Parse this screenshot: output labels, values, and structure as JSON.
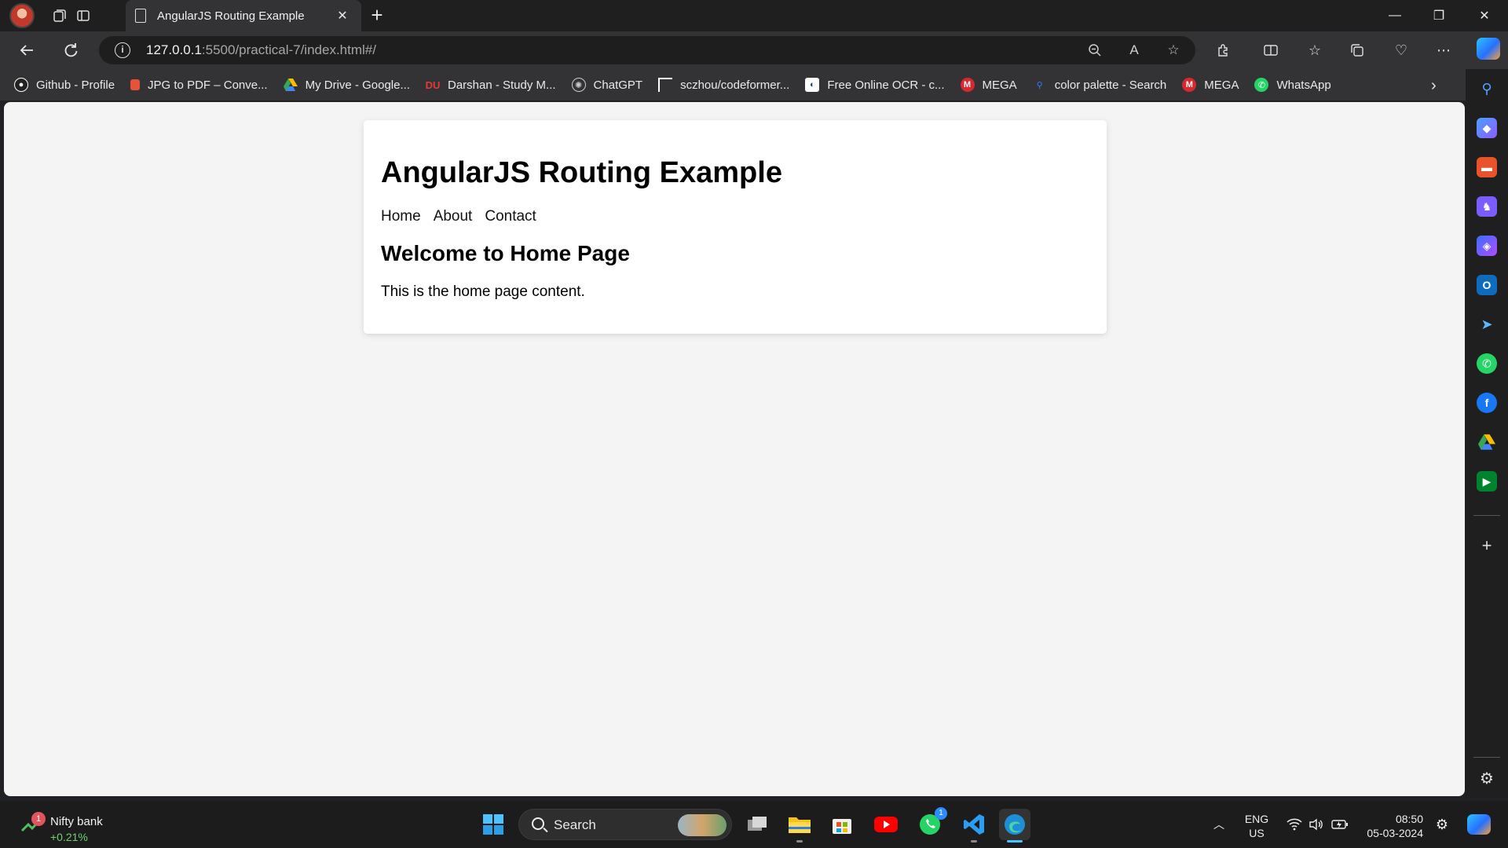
{
  "browser": {
    "tab_title": "AngularJS Routing Example",
    "url_host": "127.0.0.1",
    "url_path": ":5500/practical-7/index.html#/"
  },
  "bookmarks": [
    {
      "label": "Github - Profile",
      "icon": "github-icon",
      "color": "#ffffff"
    },
    {
      "label": "JPG to PDF – Conve...",
      "icon": "pdf-icon",
      "color": "#e5533d"
    },
    {
      "label": "My Drive - Google...",
      "icon": "google-drive-icon",
      "color": "#34a853"
    },
    {
      "label": "Darshan - Study M...",
      "icon": "darshan-icon",
      "color": "#e53935"
    },
    {
      "label": "ChatGPT",
      "icon": "chatgpt-icon",
      "color": "#d0d0d0"
    },
    {
      "label": "sczhou/codeformer...",
      "icon": "codeformer-icon",
      "color": "#ffffff"
    },
    {
      "label": "Free Online OCR - c...",
      "icon": "ocr-icon",
      "color": "#1a73e8"
    },
    {
      "label": "MEGA",
      "icon": "mega-icon",
      "color": "#d9272e"
    },
    {
      "label": "color palette - Search",
      "icon": "search-icon",
      "color": "#2f7cf6"
    },
    {
      "label": "MEGA",
      "icon": "mega-icon",
      "color": "#d9272e"
    },
    {
      "label": "WhatsApp",
      "icon": "whatsapp-icon",
      "color": "#25d366"
    }
  ],
  "page": {
    "heading": "AngularJS Routing Example",
    "nav": [
      "Home",
      "About",
      "Contact"
    ],
    "view_title": "Welcome to Home Page",
    "view_text": "This is the home page content."
  },
  "taskbar": {
    "widget_name": "Nifty bank",
    "widget_change": "+0.21%",
    "widget_badge": "1",
    "search_label": "Search",
    "whatsapp_badge": "1",
    "lang_line1": "ENG",
    "lang_line2": "US",
    "time": "08:50",
    "date": "05-03-2024"
  },
  "colors": {
    "accent": "#0078d4",
    "page_bg": "#f4f4f4",
    "browser_chrome": "#333336"
  }
}
